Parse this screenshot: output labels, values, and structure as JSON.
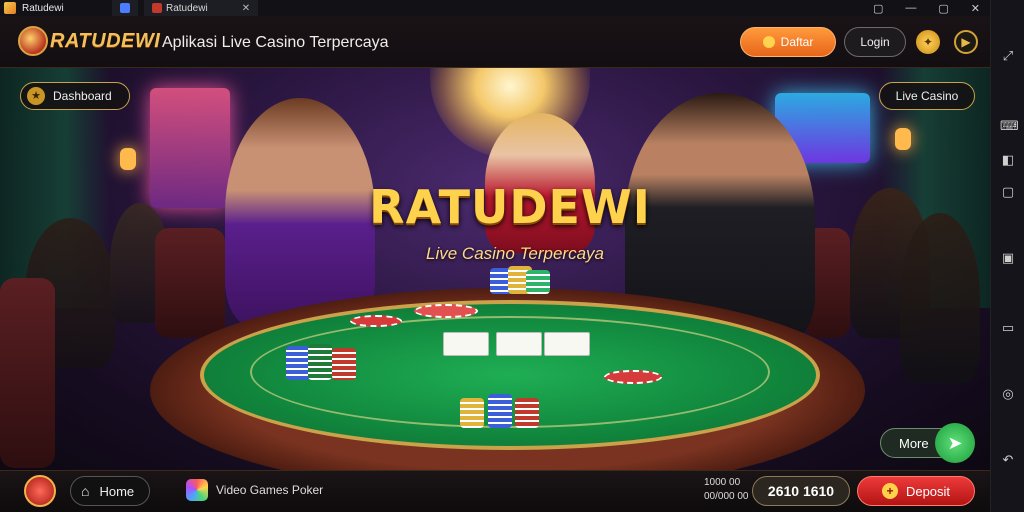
{
  "window": {
    "app_title": "Ratudewi",
    "tabs": [
      {
        "label": ""
      },
      {
        "label": "Ratudewi"
      }
    ],
    "controls": {
      "settings": "▢",
      "minimize": "—",
      "maximize": "▢",
      "close": "✕"
    }
  },
  "header": {
    "logo_text": "RATUDEWI",
    "tagline": "Aplikasi Live  Casino Terpercaya",
    "primary_button": "Daftar",
    "secondary_button": "Login",
    "icons": [
      "coin-icon",
      "play-icon"
    ]
  },
  "scene": {
    "title": "RATUDEWI",
    "subtitle": "Live Casino Terpercaya",
    "top_left_pill": "Dashboard",
    "top_right_pill": "Live Casino",
    "more_button": "More",
    "more_go": "➤"
  },
  "bottombar": {
    "home_label": "Home",
    "app_label": "Video Games Poker",
    "mini_line1": "1000 00",
    "mini_line2": "00/000 00",
    "score": "2610 1610",
    "cta_label": "Deposit",
    "cta_icon": "+"
  },
  "rail": {
    "icons": [
      "expand-icon",
      "keyboard-icon",
      "volume-icon",
      "fullscreen-icon",
      "screenshot-icon",
      "record-icon",
      "location-icon",
      "back-icon"
    ]
  },
  "colors": {
    "accent_gold": "#f4c05a",
    "orange": "#e8651a",
    "red": "#b31414",
    "felt_green": "#128a3f"
  }
}
